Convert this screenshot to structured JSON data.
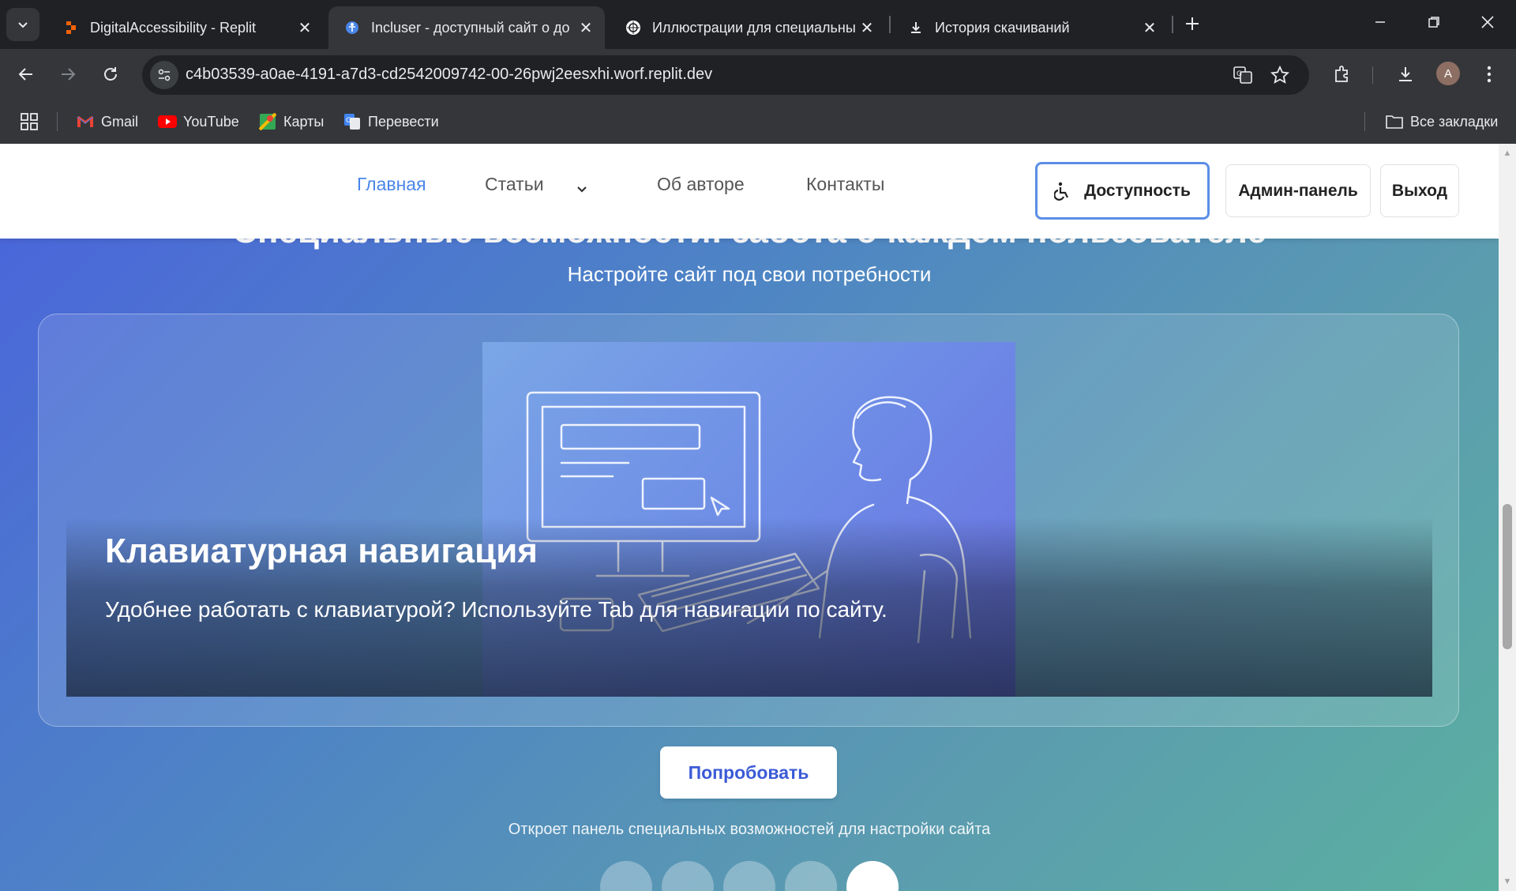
{
  "browser": {
    "tabs": [
      {
        "title": "DigitalAccessibility - Replit",
        "active": false
      },
      {
        "title": "Incluser - доступный сайт о до",
        "active": true
      },
      {
        "title": "Иллюстрации для специальны",
        "active": false
      },
      {
        "title": "История скачиваний",
        "active": false
      }
    ],
    "url": "c4b03539-a0ae-4191-a7d3-cd2542009742-00-26pwj2eesxhi.worf.replit.dev",
    "avatar_letter": "A",
    "bookmarks": [
      {
        "label": "Gmail"
      },
      {
        "label": "YouTube"
      },
      {
        "label": "Карты"
      },
      {
        "label": "Перевести"
      }
    ],
    "all_bookmarks": "Все закладки"
  },
  "site": {
    "nav": {
      "home": "Главная",
      "articles": "Статьи",
      "about": "Об авторе",
      "contacts": "Контакты"
    },
    "buttons": {
      "accessibility": "Доступность",
      "admin": "Админ-панель",
      "logout": "Выход"
    },
    "hero": {
      "title": "Специальные возможности: забота о каждом пользователе",
      "subtitle": "Настройте сайт под свои потребности"
    },
    "slide": {
      "title": "Клавиатурная навигация",
      "text": "Удобнее работать с клавиатурой? Используйте Tab для навигации по сайту.",
      "illustration_key": "Tab"
    },
    "cta": {
      "label": "Попробовать",
      "note": "Откроет панель специальных возможностей для настройки сайта"
    },
    "carousel": {
      "count": 5,
      "active_index": 4
    }
  },
  "colors": {
    "accent": "#4a86e8",
    "cta_text": "#3b5bd6",
    "focus_border": "#5b8fe6"
  }
}
